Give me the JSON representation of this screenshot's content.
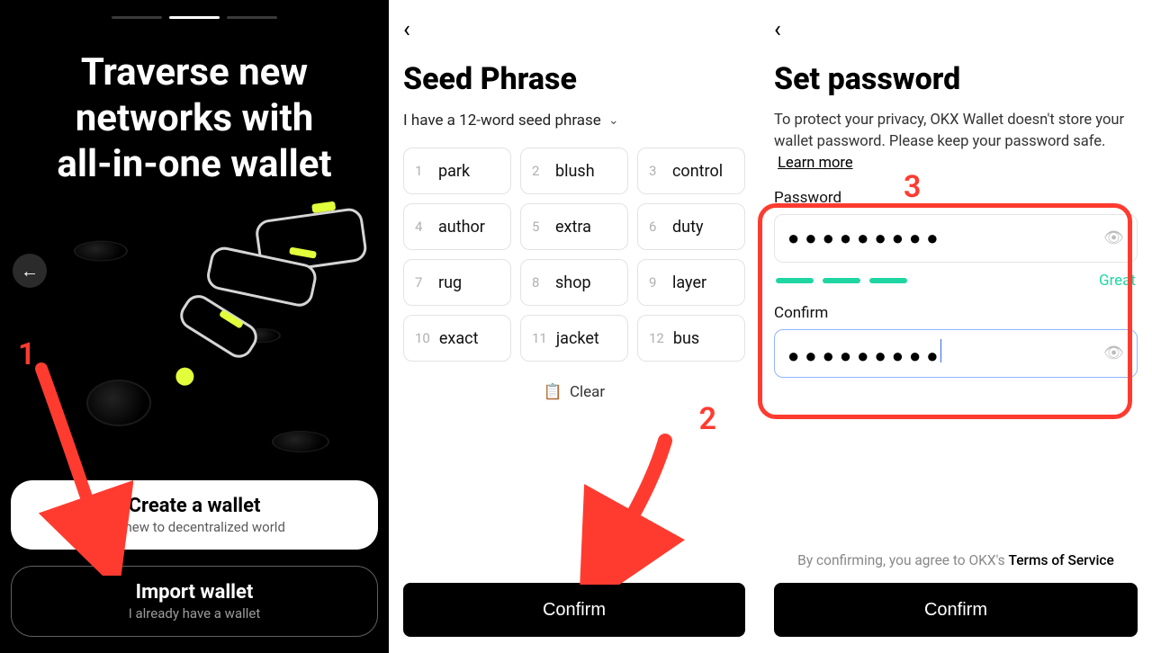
{
  "panel1": {
    "title_line1": "Traverse new",
    "title_line2": "networks with",
    "title_line3": "all-in-one wallet",
    "create": {
      "main": "Create a wallet",
      "sub": "I'm new to decentralized world"
    },
    "import": {
      "main": "Import wallet",
      "sub": "I already have a wallet"
    }
  },
  "panel2": {
    "title": "Seed Phrase",
    "selector_label": "I have a 12-word seed phrase",
    "words": [
      "park",
      "blush",
      "control",
      "author",
      "extra",
      "duty",
      "rug",
      "shop",
      "layer",
      "exact",
      "jacket",
      "bus"
    ],
    "clear_label": "Clear",
    "confirm_label": "Confirm"
  },
  "panel3": {
    "title": "Set password",
    "description": "To protect your privacy, OKX Wallet doesn't store your wallet password. Please keep your password safe.",
    "learn_more": "Learn more",
    "password_label": "Password",
    "confirm_label": "Confirm",
    "password_value": "●●●●●●●●●",
    "confirm_value": "●●●●●●●●●",
    "strength_text": "Great",
    "tos_prefix": "By confirming, you agree to OKX's ",
    "tos_link": "Terms of Service",
    "confirm_button": "Confirm"
  },
  "annotations": {
    "n1": "1",
    "n2": "2",
    "n3": "3"
  }
}
